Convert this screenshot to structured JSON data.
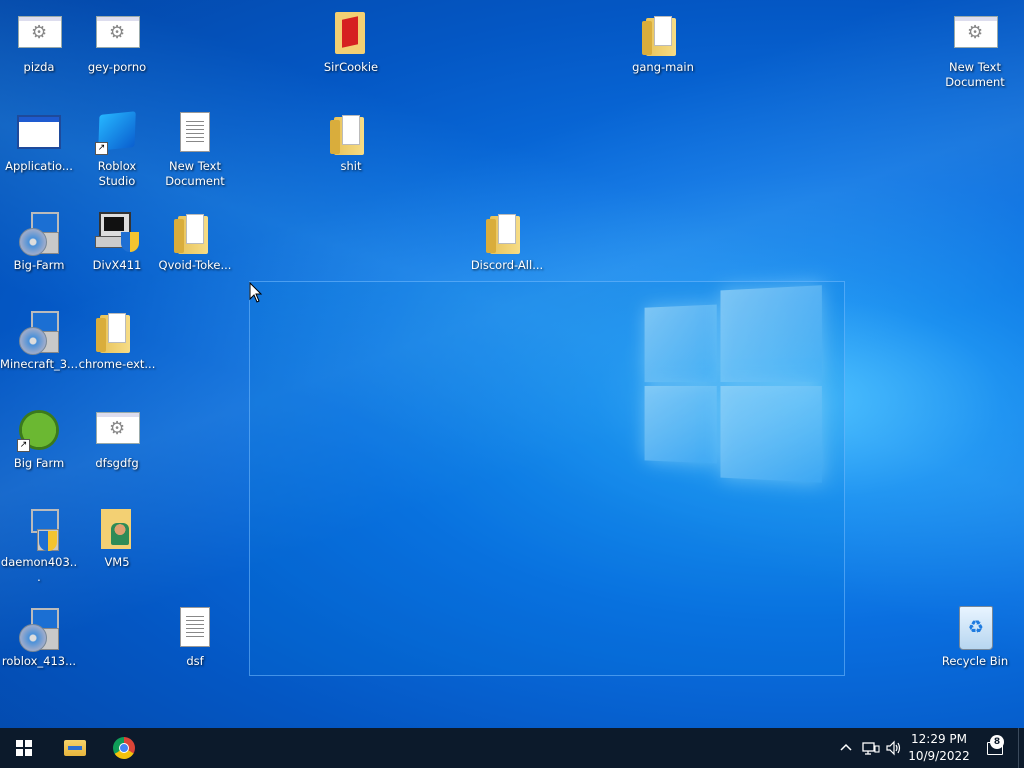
{
  "desktop": {
    "icons": [
      {
        "label": "pizda",
        "type": "config-file-icon"
      },
      {
        "label": "gey-porno",
        "type": "config-file-icon"
      },
      {
        "label": "SirCookie",
        "type": "folder-icon"
      },
      {
        "label": "gang-main",
        "type": "folder-icon"
      },
      {
        "label": "New Text Document",
        "type": "config-file-icon"
      },
      {
        "label": "Applicatio...",
        "type": "application-icon"
      },
      {
        "label": "Roblox Studio",
        "type": "roblox-studio-icon"
      },
      {
        "label": "New Text Document",
        "type": "text-file-icon"
      },
      {
        "label": "shit",
        "type": "folder-icon"
      },
      {
        "label": "Big-Farm",
        "type": "setup-icon"
      },
      {
        "label": "DivX411",
        "type": "setup-icon"
      },
      {
        "label": "Qvoid-Toke...",
        "type": "folder-icon"
      },
      {
        "label": "Discord-All...",
        "type": "folder-icon"
      },
      {
        "label": "Minecraft_3...",
        "type": "setup-icon"
      },
      {
        "label": "chrome-ext...",
        "type": "folder-icon"
      },
      {
        "label": "Big Farm",
        "type": "big-farm-icon"
      },
      {
        "label": "dfsgdfg",
        "type": "config-file-icon"
      },
      {
        "label": "daemon403...",
        "type": "setup-icon"
      },
      {
        "label": "VM5",
        "type": "user-folder-icon"
      },
      {
        "label": "roblox_413...",
        "type": "setup-icon"
      },
      {
        "label": "dsf",
        "type": "text-file-icon"
      },
      {
        "label": "Recycle Bin",
        "type": "recycle-bin-icon"
      }
    ]
  },
  "taskbar": {
    "start_icon": "windows-start-icon",
    "pinned": [
      "file-explorer-icon",
      "chrome-icon"
    ],
    "tray_icons": [
      "chevron-up-icon",
      "network-icon",
      "volume-icon"
    ],
    "time": "12:29 PM",
    "date": "10/9/2022",
    "notification_count": "8",
    "background": "#0c1a2b"
  },
  "colors": {
    "desktop_blue": "#0a6fe0",
    "selection": "#0078d7"
  }
}
